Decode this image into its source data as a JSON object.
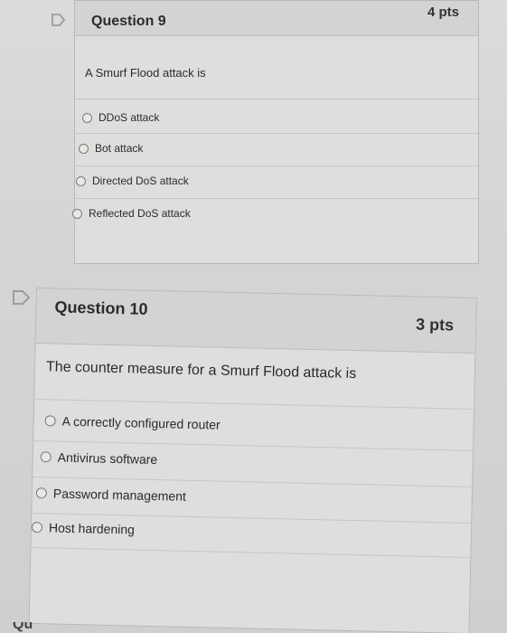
{
  "questions": [
    {
      "title": "Question 9",
      "points": "4 pts",
      "prompt": "A Smurf Flood attack is",
      "answers": [
        "DDoS attack",
        "Bot attack",
        "Directed DoS attack",
        "Reflected DoS attack"
      ]
    },
    {
      "title": "Question 10",
      "points": "3 pts",
      "prompt": "The counter measure for a Smurf Flood attack is",
      "answers": [
        "A correctly configured router",
        "Antivirus software",
        "Password management",
        "Host hardening"
      ]
    }
  ],
  "next_question_peek": "Qu",
  "icons": {
    "flag": "flag-icon"
  }
}
